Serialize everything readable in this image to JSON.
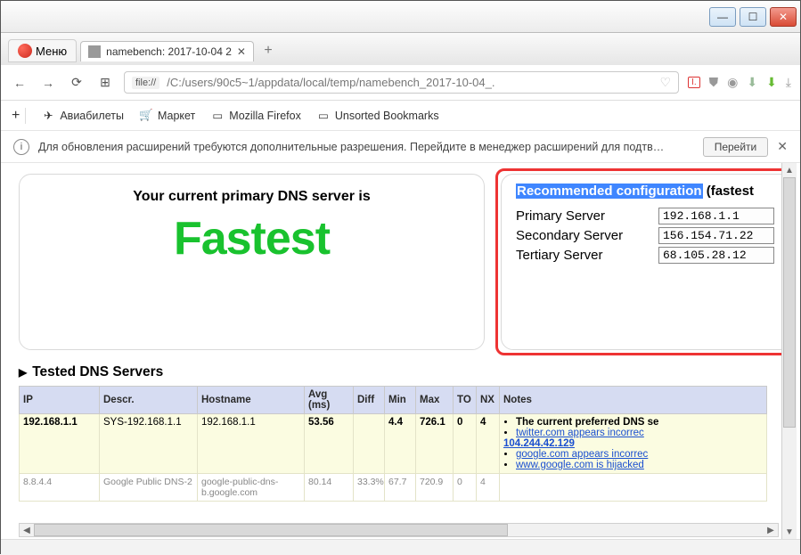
{
  "window": {
    "min": "—",
    "max": "☐",
    "close": "✕"
  },
  "browser": {
    "menu_label": "Меню",
    "tab_title": "namebench: 2017-10-04 2",
    "tab_close": "✕",
    "newtab": "+",
    "nav": {
      "back": "←",
      "fwd": "→",
      "reload": "⟳",
      "speed": "⊞"
    },
    "url_scheme": "file://",
    "url_path": "/C:/users/90c5~1/appdata/local/temp/namebench_2017-10-04_.",
    "heart": "♡",
    "right_icons": {
      "a": "⛊",
      "b": "◉",
      "c": "⬇",
      "d": "⬇",
      "e": "⤓"
    }
  },
  "bookmarks": {
    "add": "+",
    "items": [
      {
        "icon": "✈",
        "label": "Авиабилеты"
      },
      {
        "icon": "🛒",
        "label": "Маркет"
      },
      {
        "icon": "▭",
        "label": "Mozilla Firefox"
      },
      {
        "icon": "▭",
        "label": "Unsorted Bookmarks"
      }
    ]
  },
  "infobar": {
    "text": "Для обновления расширений требуются дополнительные разрешения. Перейдите в менеджер расширений для подтв…",
    "go": "Перейти",
    "close": "✕"
  },
  "page": {
    "left_title": "Your current primary DNS server is",
    "fastest": "Fastest",
    "rec_title_selected": "Recommended configuration",
    "rec_title_rest": " (fastest",
    "servers": {
      "primary_label": "Primary Server",
      "primary_value": "192.168.1.1",
      "secondary_label": "Secondary Server",
      "secondary_value": "156.154.71.22",
      "tertiary_label": "Tertiary Server",
      "tertiary_value": "68.105.28.12"
    },
    "tested_header": "Tested DNS Servers",
    "table": {
      "headers": {
        "ip": "IP",
        "descr": "Descr.",
        "host": "Hostname",
        "avg": "Avg (ms)",
        "diff": "Diff",
        "min": "Min",
        "max": "Max",
        "to": "TO",
        "nx": "NX",
        "notes": "Notes"
      },
      "row1": {
        "ip": "192.168.1.1",
        "descr": "SYS-192.168.1.1",
        "host": "192.168.1.1",
        "avg": "53.56",
        "diff": "",
        "min": "4.4",
        "max": "726.1",
        "to": "0",
        "nx": "4",
        "note1": "The current preferred DNS se",
        "note2": "twitter.com appears incorrec",
        "note2ip": "104.244.42.129",
        "note3": "google.com appears incorrec",
        "note4": "www.google.com is hijacked"
      },
      "row2": {
        "ip": "8.8.4.4",
        "descr": "Google Public DNS-2",
        "host": "google-public-dns-b.google.com",
        "avg": "80.14",
        "diff": "33.3%",
        "min": "67.7",
        "max": "720.9",
        "to": "0",
        "nx": "4"
      }
    }
  }
}
